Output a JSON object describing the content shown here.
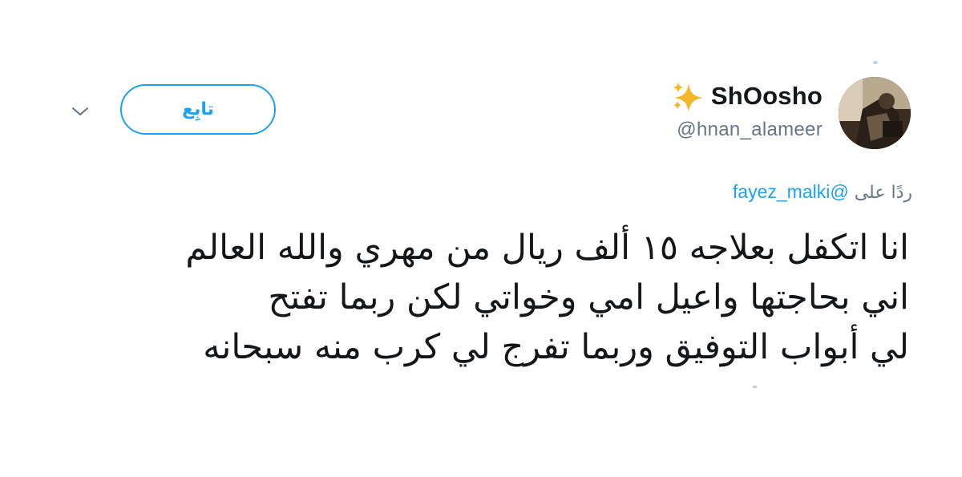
{
  "user": {
    "display_name": "ShOosho",
    "name_emoji_icon": "sparkles-icon",
    "handle": "@hnan_alameer",
    "avatar_icon": "profile-photo"
  },
  "actions": {
    "follow_label": "تابِع",
    "menu_icon": "chevron-down-icon"
  },
  "reply": {
    "prefix": "ردًا على",
    "mention": "@fayez_malki"
  },
  "tweet": {
    "lines": [
      "انا اتكفل بعلاجه ١٥ ألف ريال من مهري والله العالم",
      "اني بحاجتها واعيل امي وخواتي لكن ربما تفتح",
      "لي أبواب التوفيق وربما تفرج لي كرب منه سبحانه"
    ]
  },
  "colors": {
    "accent": "#1da1f2",
    "text": "#14171a",
    "secondary": "#657786",
    "sparkle": "#f5b72a"
  }
}
